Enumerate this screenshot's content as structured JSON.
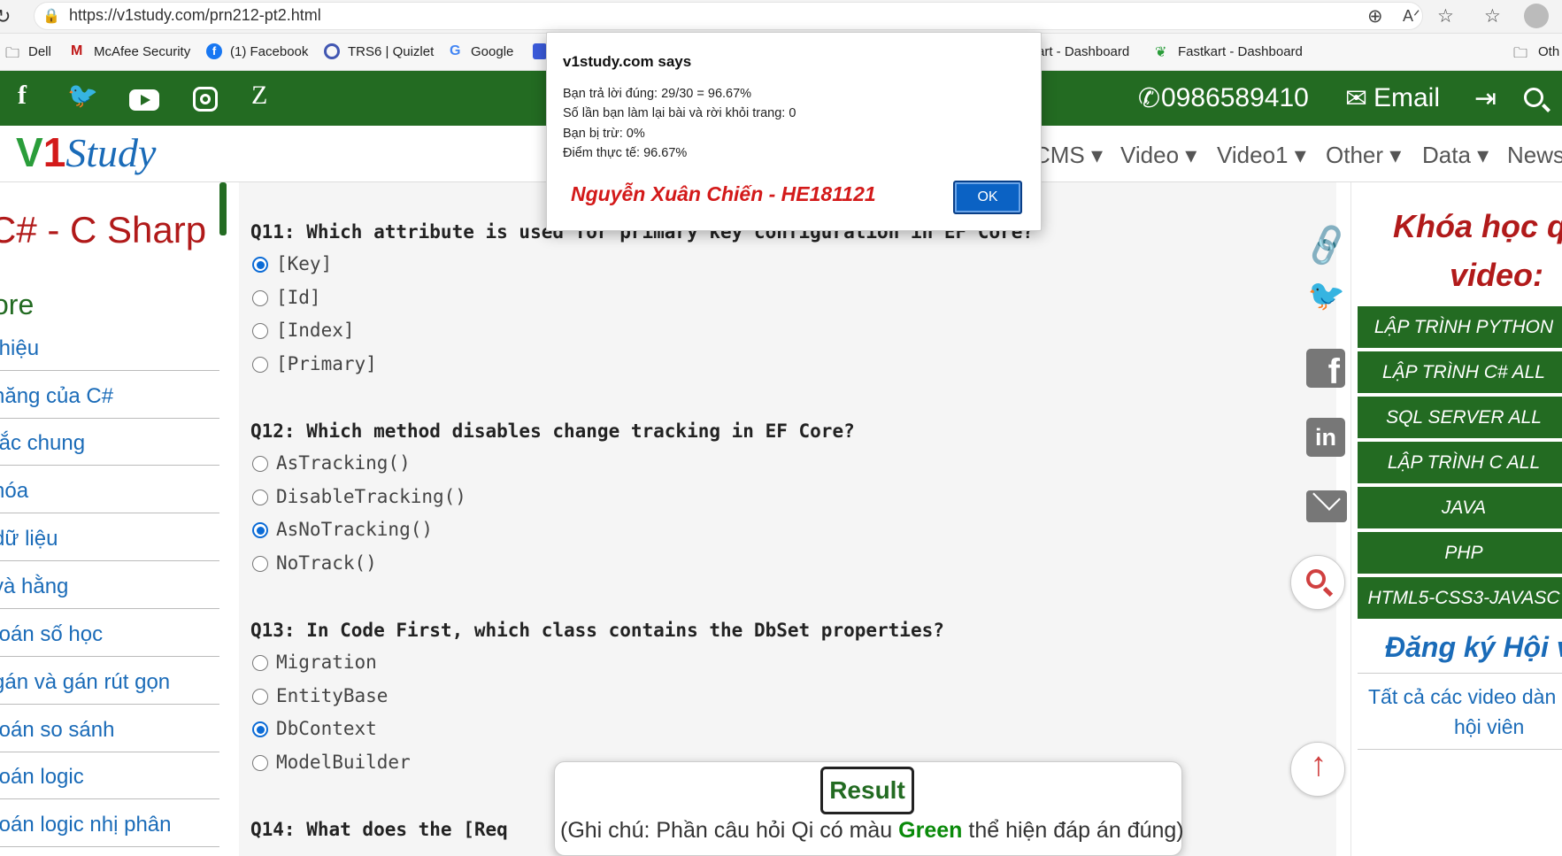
{
  "browser": {
    "url": "https://v1study.com/prn212-pt2.html",
    "bookmarks": [
      "Dell",
      "McAfee Security",
      "(1) Facebook",
      "TRS6 | Quizlet",
      "Google",
      "art - Dashboard",
      "Fastkart - Dashboard",
      "Oth"
    ]
  },
  "topbar": {
    "social": [
      "f",
      "twitter",
      "youtube",
      "instagram",
      "Z"
    ],
    "phone": "0986589410",
    "email": "Email"
  },
  "nav": {
    "logo_v": "V",
    "logo_1": "1",
    "logo_study": "Study",
    "items": [
      "CMS",
      "Video",
      "Video1",
      "Other",
      "Data",
      "News"
    ]
  },
  "left_sidebar": {
    "title": "C# - C Sharp",
    "section": "ore",
    "links": [
      "thiệu",
      "năng của C#",
      "tắc chung",
      "hóa",
      "dữ liệu",
      "và hằng",
      "toán số học",
      "gán và gán rút gọn",
      "toán so sánh",
      "toán logic",
      "toán logic nhị phân"
    ]
  },
  "questions": [
    {
      "text": "Q11: Which attribute is used for primary key configuration in EF Core?",
      "options": [
        "[Key]",
        "[Id]",
        "[Index]",
        "[Primary]"
      ],
      "selected": 0
    },
    {
      "text": "Q12: Which method disables change tracking in EF Core?",
      "options": [
        "AsTracking()",
        "DisableTracking()",
        "AsNoTracking()",
        "NoTrack()"
      ],
      "selected": 2
    },
    {
      "text": "Q13: In Code First, which class contains the DbSet properties?",
      "options": [
        "Migration",
        "EntityBase",
        "DbContext",
        "ModelBuilder"
      ],
      "selected": 2
    },
    {
      "text": "Q14: What does the [Req",
      "options": [],
      "selected": -1
    }
  ],
  "right_sidebar": {
    "heading1": "Khóa học qu",
    "heading2": "video:",
    "courses": [
      "LẬP TRÌNH PYTHON",
      "LẬP TRÌNH C# ALL",
      "SQL SERVER ALL",
      "LẬP TRÌNH C ALL",
      "JAVA",
      "PHP",
      "HTML5-CSS3-JAVASC"
    ],
    "register": "Đăng ký Hội vi",
    "all_videos_1": "Tất cả các video dàn",
    "all_videos_2": "hội viên"
  },
  "dialog": {
    "title": "v1study.com says",
    "lines": [
      "Bạn trả lời đúng: 29/30 = 96.67%",
      "Số lần bạn làm lại bài và rời khỏi trang: 0",
      "Bạn bị trừ: 0%",
      "Điểm thực tế: 96.67%"
    ],
    "name": "Nguyễn Xuân Chiến - HE181121",
    "ok": "OK"
  },
  "result": {
    "button": "Result",
    "note_pre": "(Ghi chú: Phần câu hỏi Qi có màu ",
    "note_green": "Green",
    "note_post": " thể hiện đáp án đúng)"
  },
  "colors": {
    "brand_green": "#236b22",
    "title_red": "#b11a1a",
    "link_blue": "#1a6bb8",
    "accent_blue": "#0b6bd6"
  }
}
